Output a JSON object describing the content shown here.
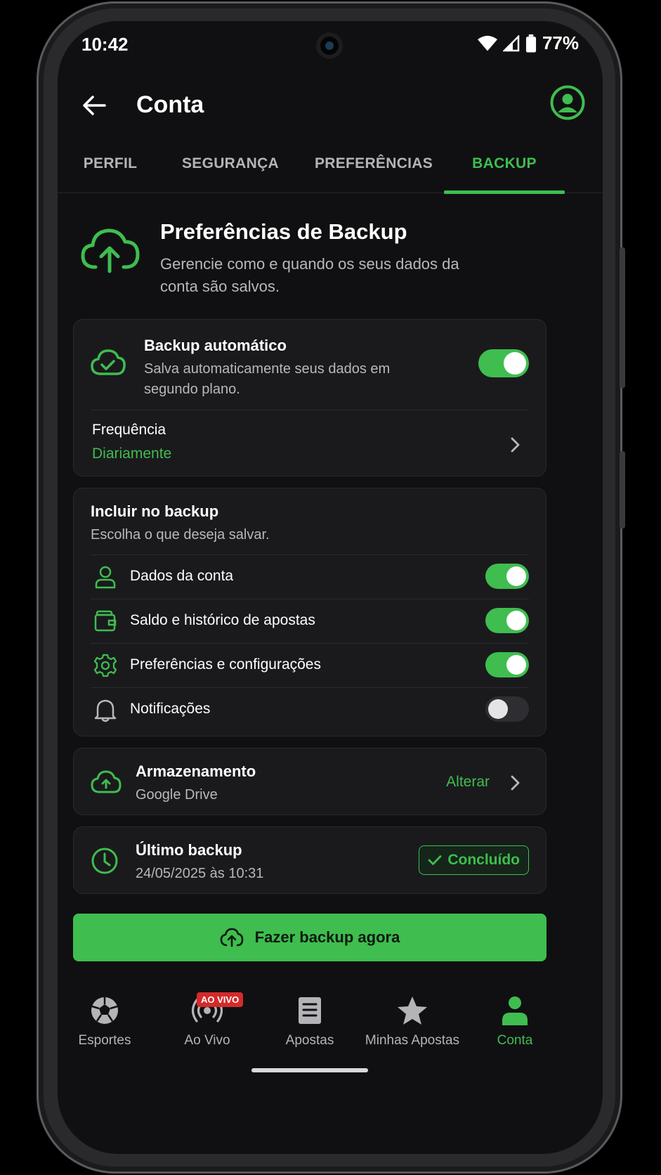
{
  "status": {
    "time": "10:42",
    "battery": "77%"
  },
  "appbar": {
    "title": "Conta"
  },
  "tabs": [
    {
      "label": "PERFIL"
    },
    {
      "label": "SEGURANÇA"
    },
    {
      "label": "PREFERÊNCIAS"
    },
    {
      "label": "BACKUP",
      "active": true
    }
  ],
  "header": {
    "title": "Preferências de Backup",
    "subtitle": "Gerencie como e quando os seus dados da conta são salvos."
  },
  "auto_backup": {
    "title": "Backup automático",
    "subtitle": "Salva automaticamente seus dados em segundo plano.",
    "enabled": true,
    "frequency_label": "Frequência",
    "frequency_value": "Diariamente"
  },
  "include": {
    "title": "Incluir no backup",
    "subtitle": "Escolha o que deseja salvar.",
    "items": [
      {
        "label": "Dados da conta",
        "icon": "person-icon",
        "enabled": true
      },
      {
        "label": "Saldo e histórico de apostas",
        "icon": "wallet-icon",
        "enabled": true
      },
      {
        "label": "Preferências e configurações",
        "icon": "gear-icon",
        "enabled": true
      },
      {
        "label": "Notificações",
        "icon": "bell-icon",
        "enabled": false
      }
    ]
  },
  "storage": {
    "title": "Armazenamento",
    "value": "Google Drive",
    "action": "Alterar"
  },
  "last_backup": {
    "title": "Último backup",
    "value": "24/05/2025 às 10:31",
    "status": "Concluído"
  },
  "cta": {
    "label": "Fazer backup agora"
  },
  "bottom_nav": [
    {
      "label": "Esportes",
      "icon": "soccer-ball-icon"
    },
    {
      "label": "Ao Vivo",
      "icon": "live-broadcast-icon",
      "badge": "AO VIVO"
    },
    {
      "label": "Apostas",
      "icon": "ticket-icon"
    },
    {
      "label": "Minhas Apostas",
      "icon": "star-icon"
    },
    {
      "label": "Conta",
      "icon": "person-icon",
      "active": true
    }
  ],
  "colors": {
    "accent": "#3fbd4f",
    "background": "#101012",
    "card": "#1a1a1d",
    "live": "#d42a2a"
  }
}
